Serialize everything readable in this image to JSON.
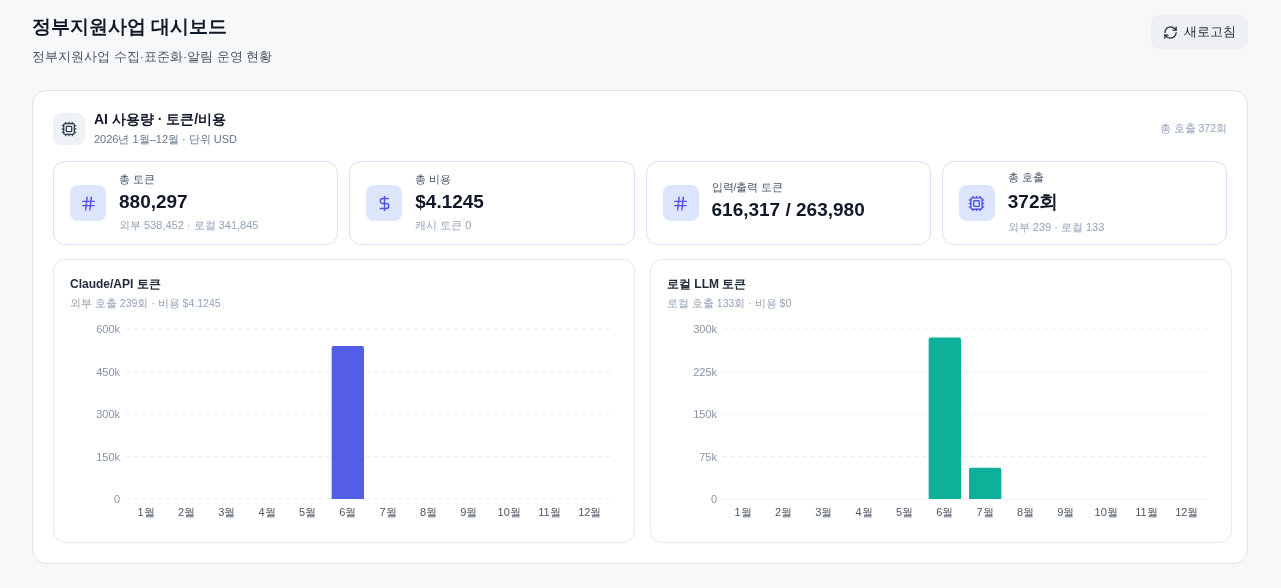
{
  "header": {
    "title": "정부지원사업 대시보드",
    "subtitle": "정부지원사업 수집·표준화·알림 운영 현황",
    "refresh_button": "새로고침"
  },
  "panel": {
    "title": "AI 사용량 · 토큰/비용",
    "subtitle": "2026년 1월–12월 · 단위 USD",
    "summary": "총 호출 372회",
    "stats": [
      {
        "kind": "hash",
        "label": "총 토큰",
        "value": "880,297",
        "note": "외부 538,452 · 로컬 341,845"
      },
      {
        "kind": "dollar",
        "label": "총 비용",
        "value": "$4.1245",
        "note": "캐시 토큰 0"
      },
      {
        "kind": "hash",
        "label": "입력/출력 토큰",
        "value": "616,317 / 263,980"
      },
      {
        "kind": "chip",
        "label": "총 호출",
        "value": "372회",
        "note": "외부 239 · 로컬 133"
      }
    ],
    "charts": [
      {
        "subtitle": "외부 호출 239회 · 비용 $4.1245",
        "chart_data": {
          "type": "bar",
          "title": "Claude/API 토큰",
          "grid": true,
          "categories": [
            "1월",
            "2월",
            "3월",
            "4월",
            "5월",
            "6월",
            "7월",
            "8월",
            "9월",
            "10월",
            "11월",
            "12월"
          ],
          "series": [
            {
              "color": "#545de8",
              "values": [
                0,
                0,
                0,
                0,
                0,
                540000,
                0,
                0,
                0,
                0,
                0,
                0
              ]
            }
          ],
          "ylim": [
            0,
            600000
          ],
          "yticks": [
            {
              "value": 0,
              "label": "0"
            },
            {
              "value": 150000,
              "label": "150k"
            },
            {
              "value": 300000,
              "label": "300k"
            },
            {
              "value": 450000,
              "label": "450k"
            },
            {
              "value": 600000,
              "label": "600k"
            }
          ]
        }
      },
      {
        "subtitle": "로컬 호출 133회 · 비용 $0",
        "chart_data": {
          "type": "bar",
          "title": "로컬 LLM 토큰",
          "grid": true,
          "categories": [
            "1월",
            "2월",
            "3월",
            "4월",
            "5월",
            "6월",
            "7월",
            "8월",
            "9월",
            "10월",
            "11월",
            "12월"
          ],
          "series": [
            {
              "color": "#0fb09a",
              "values": [
                0,
                0,
                0,
                0,
                0,
                285000,
                55000,
                0,
                0,
                0,
                0,
                0
              ]
            }
          ],
          "ylim": [
            0,
            300000
          ],
          "yticks": [
            {
              "value": 0,
              "label": "0"
            },
            {
              "value": 75000,
              "label": "75k"
            },
            {
              "value": 150000,
              "label": "150k"
            },
            {
              "value": 225000,
              "label": "225k"
            },
            {
              "value": 300000,
              "label": "300k"
            }
          ]
        }
      }
    ]
  }
}
